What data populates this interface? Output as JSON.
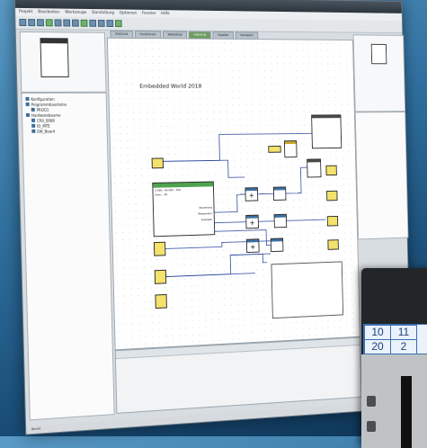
{
  "app": {
    "title": "",
    "menu": [
      "Projekt",
      "Bearbeiten",
      "Werkzeuge",
      "Darstellung",
      "Optionen",
      "Fenster",
      "Hilfe"
    ],
    "tabs": [
      {
        "label": "EW2018"
      },
      {
        "label": "Funktionen"
      },
      {
        "label": "Bibliothek"
      },
      {
        "label": "EW2018"
      },
      {
        "label": "Objekte"
      },
      {
        "label": "Variablen"
      }
    ]
  },
  "project_tree": {
    "items": [
      {
        "label": "Konfiguration",
        "level": 0
      },
      {
        "label": "Programmbausteine",
        "level": 0
      },
      {
        "label": "PROG1",
        "level": 1
      },
      {
        "label": "Hardwarebaume",
        "level": 0
      },
      {
        "label": "CR0_0068",
        "level": 1
      },
      {
        "label": "IO_MTE",
        "level": 1
      },
      {
        "label": "EW_Board",
        "level": 1
      }
    ]
  },
  "canvas": {
    "title": "Embedded World 2018",
    "main_block_rows": [
      "0 600 - 60 000 - 312",
      "Dom... 30"
    ],
    "main_block_outputs": [
      "Steuerung",
      "Temperatur",
      "Drehzahl"
    ]
  },
  "device_display": {
    "cells": [
      "10",
      "11",
      "20",
      "2"
    ]
  },
  "status": {
    "text": "Bereit"
  },
  "colors": {
    "accent_green": "#4fa34f",
    "block_yellow": "#f3e26b",
    "background_blue": "#2f6f9e"
  }
}
